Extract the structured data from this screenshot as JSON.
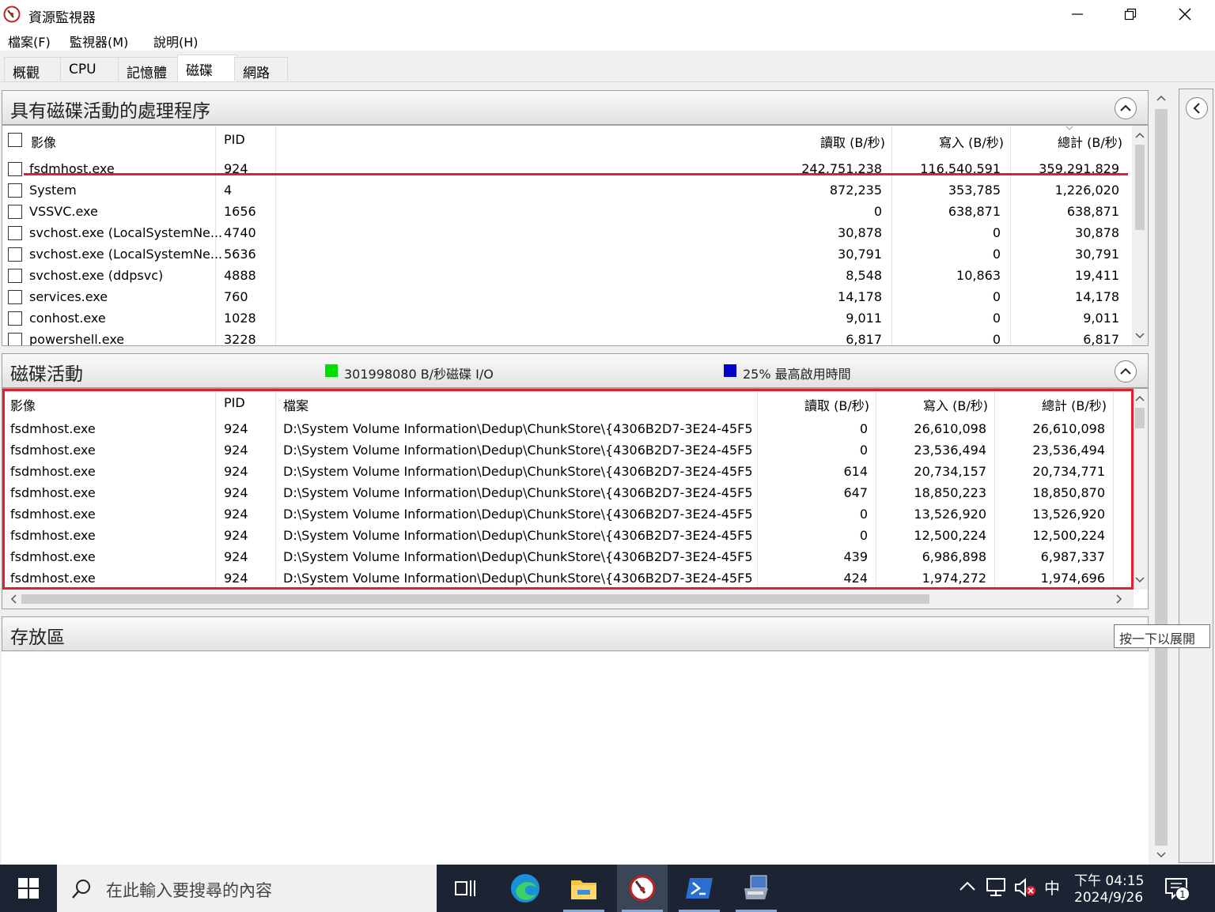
{
  "window": {
    "title": "資源監視器"
  },
  "menu": [
    "檔案(F)",
    "監視器(M)",
    "說明(H)"
  ],
  "tabs": [
    {
      "label": "概觀",
      "active": false
    },
    {
      "label": "CPU",
      "active": false
    },
    {
      "label": "記憶體",
      "active": false
    },
    {
      "label": "磁碟",
      "active": true
    },
    {
      "label": "網路",
      "active": false
    }
  ],
  "processes": {
    "title": "具有磁碟活動的處理程序",
    "columns": {
      "image": "影像",
      "pid": "PID",
      "read": "讀取 (B/秒)",
      "write": "寫入 (B/秒)",
      "total": "總計 (B/秒)"
    },
    "rows": [
      {
        "image": "fsdmhost.exe",
        "pid": "924",
        "read": "242,751,238",
        "write": "116,540,591",
        "total": "359,291,829"
      },
      {
        "image": "System",
        "pid": "4",
        "read": "872,235",
        "write": "353,785",
        "total": "1,226,020"
      },
      {
        "image": "VSSVC.exe",
        "pid": "1656",
        "read": "0",
        "write": "638,871",
        "total": "638,871"
      },
      {
        "image": "svchost.exe (LocalSystemNe...",
        "pid": "4740",
        "read": "30,878",
        "write": "0",
        "total": "30,878"
      },
      {
        "image": "svchost.exe (LocalSystemNe...",
        "pid": "5636",
        "read": "30,791",
        "write": "0",
        "total": "30,791"
      },
      {
        "image": "svchost.exe (ddpsvc)",
        "pid": "4888",
        "read": "8,548",
        "write": "10,863",
        "total": "19,411"
      },
      {
        "image": "services.exe",
        "pid": "760",
        "read": "14,178",
        "write": "0",
        "total": "14,178"
      },
      {
        "image": "conhost.exe",
        "pid": "1028",
        "read": "9,011",
        "write": "0",
        "total": "9,011"
      },
      {
        "image": "powershell.exe",
        "pid": "3228",
        "read": "6,817",
        "write": "0",
        "total": "6,817"
      }
    ]
  },
  "disk_activity": {
    "title": "磁碟活動",
    "legend_io": "301998080 B/秒磁碟 I/O",
    "legend_active": "25% 最高啟用時間",
    "io_color": "#00e000",
    "active_color": "#0000c8",
    "columns": {
      "image": "影像",
      "pid": "PID",
      "file": "檔案",
      "read": "讀取 (B/秒)",
      "write": "寫入 (B/秒)",
      "total": "總計 (B/秒)"
    },
    "rows": [
      {
        "image": "fsdmhost.exe",
        "pid": "924",
        "file": "D:\\System Volume Information\\Dedup\\ChunkStore\\{4306B2D7-3E24-45F5...",
        "read": "0",
        "write": "26,610,098",
        "total": "26,610,098"
      },
      {
        "image": "fsdmhost.exe",
        "pid": "924",
        "file": "D:\\System Volume Information\\Dedup\\ChunkStore\\{4306B2D7-3E24-45F5...",
        "read": "0",
        "write": "23,536,494",
        "total": "23,536,494"
      },
      {
        "image": "fsdmhost.exe",
        "pid": "924",
        "file": "D:\\System Volume Information\\Dedup\\ChunkStore\\{4306B2D7-3E24-45F5...",
        "read": "614",
        "write": "20,734,157",
        "total": "20,734,771"
      },
      {
        "image": "fsdmhost.exe",
        "pid": "924",
        "file": "D:\\System Volume Information\\Dedup\\ChunkStore\\{4306B2D7-3E24-45F5...",
        "read": "647",
        "write": "18,850,223",
        "total": "18,850,870"
      },
      {
        "image": "fsdmhost.exe",
        "pid": "924",
        "file": "D:\\System Volume Information\\Dedup\\ChunkStore\\{4306B2D7-3E24-45F5...",
        "read": "0",
        "write": "13,526,920",
        "total": "13,526,920"
      },
      {
        "image": "fsdmhost.exe",
        "pid": "924",
        "file": "D:\\System Volume Information\\Dedup\\ChunkStore\\{4306B2D7-3E24-45F5...",
        "read": "0",
        "write": "12,500,224",
        "total": "12,500,224"
      },
      {
        "image": "fsdmhost.exe",
        "pid": "924",
        "file": "D:\\System Volume Information\\Dedup\\ChunkStore\\{4306B2D7-3E24-45F5...",
        "read": "439",
        "write": "6,986,898",
        "total": "6,987,337"
      },
      {
        "image": "fsdmhost.exe",
        "pid": "924",
        "file": "D:\\System Volume Information\\Dedup\\ChunkStore\\{4306B2D7-3E24-45F5...",
        "read": "424",
        "write": "1,974,272",
        "total": "1,974,696"
      }
    ]
  },
  "storage": {
    "title": "存放區",
    "tooltip": "按一下以展開"
  },
  "taskbar": {
    "search_placeholder": "在此輸入要搜尋的內容",
    "ime": "中",
    "time": "下午 04:15",
    "date": "2024/9/26",
    "notification_count": "1"
  },
  "colors": {
    "highlight": "#e0202c",
    "taskbar": "#1c2433"
  }
}
